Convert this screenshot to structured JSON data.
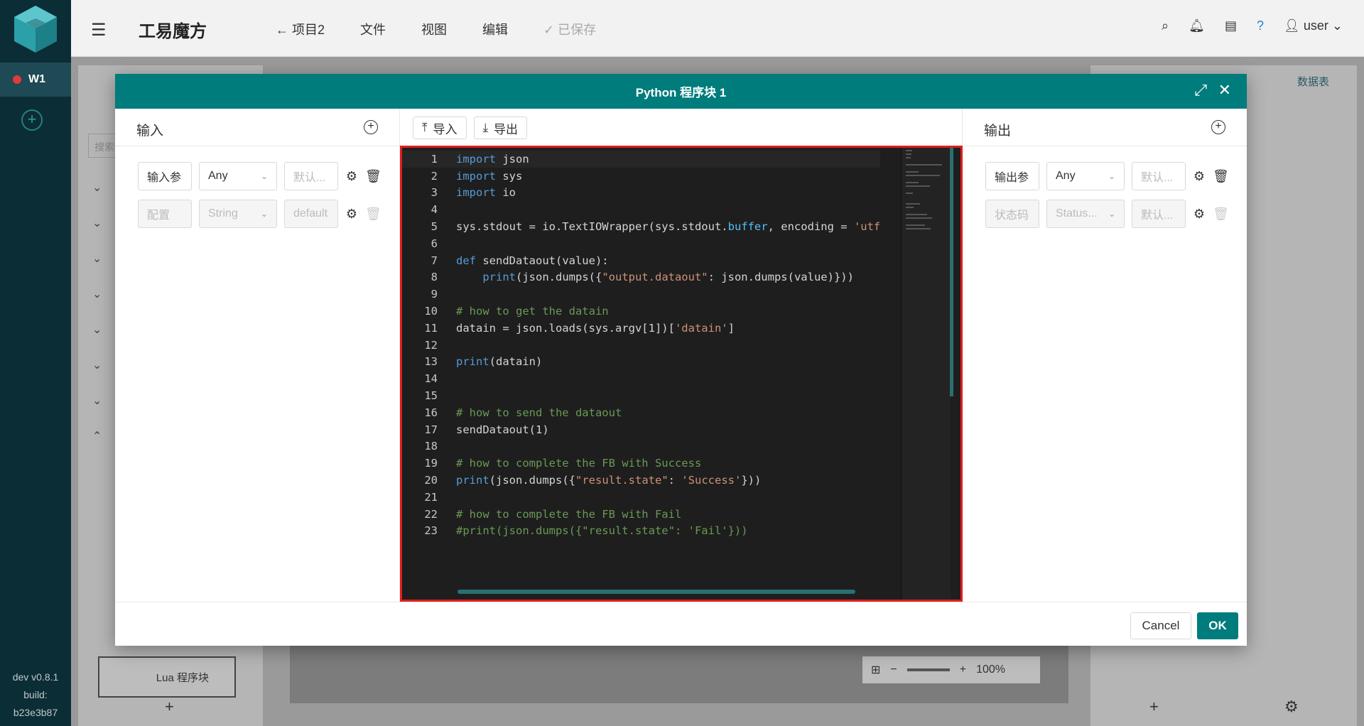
{
  "app": {
    "title": "工易魔方",
    "workspace_tab": "W1",
    "version_lines": [
      "dev v0.8.1",
      "build:",
      "b23e3b87"
    ]
  },
  "nav": {
    "back_project": "项目2",
    "file": "文件",
    "view": "视图",
    "edit": "编辑",
    "saved": "已保存"
  },
  "user": {
    "name": "user"
  },
  "background": {
    "search_placeholder": "搜索",
    "data_table_tab": "数据表",
    "lua_block": "Lua 程序块",
    "zoom_level": "100%"
  },
  "modal": {
    "title": "Python 程序块 1",
    "input_title": "输入",
    "output_title": "输出",
    "import_label": "导入",
    "export_label": "导出",
    "cancel_label": "Cancel",
    "ok_label": "OK",
    "inputs": [
      {
        "name": "输入参",
        "type": "Any",
        "default": "默认...",
        "disabled": false
      },
      {
        "name": "配置",
        "type": "String",
        "default": "default",
        "disabled": true
      }
    ],
    "outputs": [
      {
        "name": "输出参",
        "type": "Any",
        "default": "默认...",
        "disabled": false
      },
      {
        "name": "状态码",
        "type": "Status...",
        "default": "默认...",
        "disabled": true
      }
    ]
  },
  "editor": {
    "line_numbers": [
      "1",
      "2",
      "3",
      "4",
      "5",
      "6",
      "7",
      "8",
      "9",
      "10",
      "11",
      "12",
      "13",
      "14",
      "15",
      "16",
      "17",
      "18",
      "19",
      "20",
      "21",
      "22",
      "23"
    ],
    "code": [
      "import json",
      "import sys",
      "import io",
      "",
      "sys.stdout = io.TextIOWrapper(sys.stdout.buffer, encoding = 'utf",
      "",
      "def sendDataout(value):",
      "    print(json.dumps({\"output.dataout\": json.dumps(value)}))",
      "",
      "# how to get the datain",
      "datain = json.loads(sys.argv[1])['datain']",
      "",
      "print(datain)",
      "",
      "",
      "# how to send the dataout",
      "sendDataout(1)",
      "",
      "# how to complete the FB with Success",
      "print(json.dumps({\"result.state\": 'Success'}))",
      "",
      "# how to complete the FB with Fail",
      "#print(json.dumps({\"result.state\": 'Fail'}))"
    ]
  },
  "colors": {
    "teal": "#007c7c",
    "editor_bg": "#1e1e1e",
    "highlight_border": "#e01e1e"
  }
}
